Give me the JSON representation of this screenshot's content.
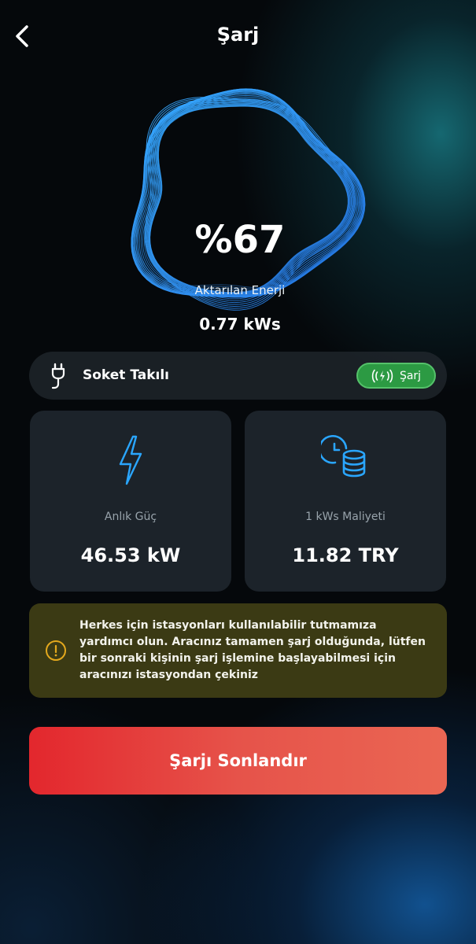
{
  "header": {
    "title": "Şarj"
  },
  "charge": {
    "percent": "%67",
    "energy_label": "Aktarılan Enerji",
    "energy_value": "0.77 kWs"
  },
  "socket": {
    "label": "Soket Takılı",
    "badge_label": "Şarj"
  },
  "cards": [
    {
      "label": "Anlık Güç",
      "value": "46.53 kW",
      "icon": "lightning-icon"
    },
    {
      "label": "1 kWs Maliyeti",
      "value": "11.82 TRY",
      "icon": "clock-coins-icon"
    }
  ],
  "notice": {
    "text": "Herkes için istasyonları kullanılabilir tutmamıza yardımcı olun. Aracınız tamamen şarj olduğunda, lütfen bir sonraki kişinin şarj işlemine başlayabilmesi için aracınızı istasyondan çekiniz",
    "icon": "info-icon"
  },
  "actions": {
    "end_charge_label": "Şarjı Sonlandır"
  },
  "colors": {
    "accent": "#2aa6ff",
    "charging_green": "#2c9a43",
    "notice_bg": "#3b3a14",
    "notice_icon": "#e3a81d",
    "button_start": "#e3272d",
    "button_end": "#ea6653"
  }
}
